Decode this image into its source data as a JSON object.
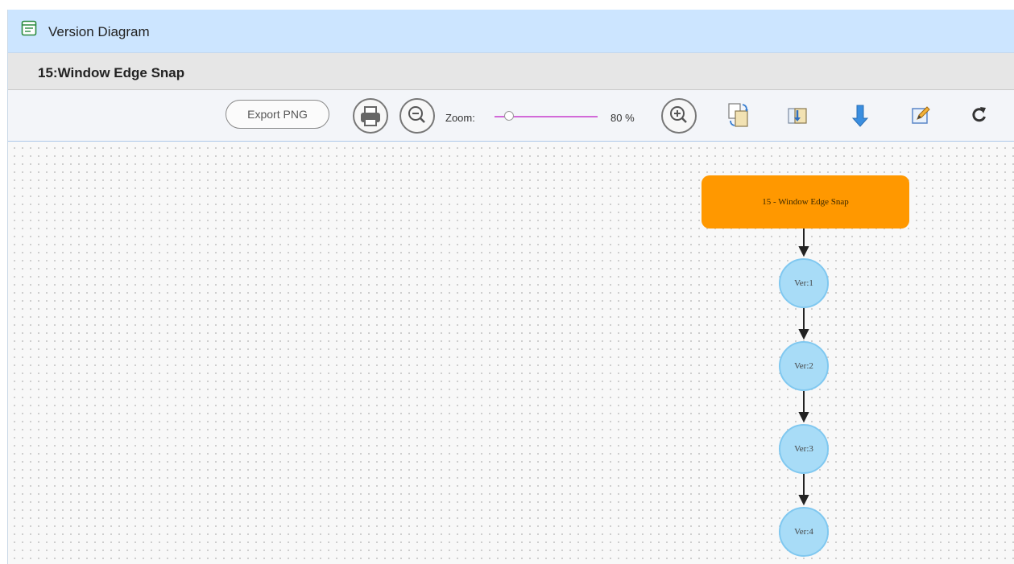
{
  "window": {
    "title": "Version Diagram",
    "subtitle": "15:Window Edge Snap"
  },
  "toolbar": {
    "export_label": "Export PNG",
    "zoom_label": "Zoom:",
    "zoom_value_text": "80 %",
    "zoom_level_fraction": 0.06,
    "slider_color": "#d26ad8"
  },
  "diagram": {
    "root_label": "15 - Window Edge Snap",
    "root_color": "#ff9800",
    "version_color": "#a8dcf7",
    "versions": [
      "Ver:1",
      "Ver:2",
      "Ver:3",
      "Ver:4"
    ]
  },
  "icons": [
    "document-list-icon",
    "print-icon",
    "zoom-out-icon",
    "zoom-in-icon",
    "copy-compare-icon",
    "page-import-icon",
    "download-arrow-icon",
    "edit-pencil-icon",
    "refresh-icon"
  ]
}
